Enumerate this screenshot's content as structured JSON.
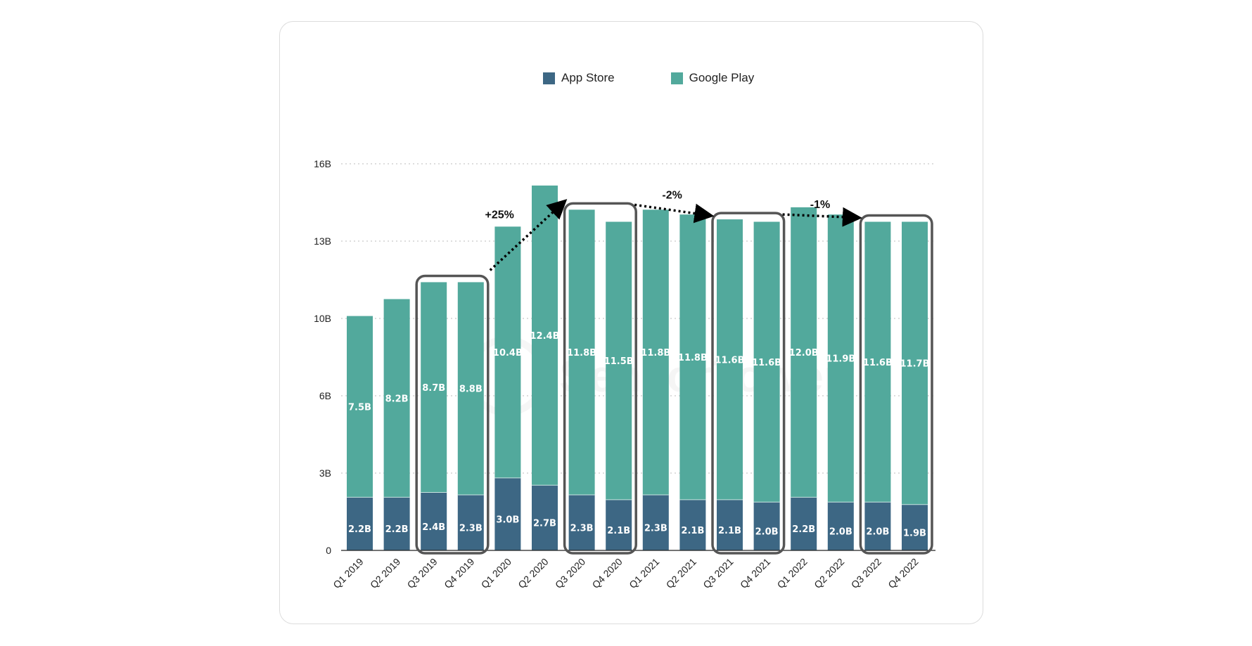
{
  "legend": [
    {
      "name": "App Store",
      "color": "#3d6784"
    },
    {
      "name": "Google Play",
      "color": "#52a99c"
    }
  ],
  "watermark": "SensorTower",
  "chart_data": {
    "type": "bar",
    "stacked": true,
    "title": "",
    "xlabel": "",
    "ylabel": "",
    "categories": [
      "Q1 2019",
      "Q2 2019",
      "Q3 2019",
      "Q4 2019",
      "Q1 2020",
      "Q2 2020",
      "Q3 2020",
      "Q4 2020",
      "Q1 2021",
      "Q2 2021",
      "Q3 2021",
      "Q4 2021",
      "Q1 2022",
      "Q2 2022",
      "Q3 2022",
      "Q4 2022"
    ],
    "series": [
      {
        "name": "App Store",
        "color": "#3d6784",
        "values": [
          2.2,
          2.2,
          2.4,
          2.3,
          3.0,
          2.7,
          2.3,
          2.1,
          2.3,
          2.1,
          2.1,
          2.0,
          2.2,
          2.0,
          2.0,
          1.9
        ],
        "labels": [
          "2.2B",
          "2.2B",
          "2.4B",
          "2.3B",
          "3.0B",
          "2.7B",
          "2.3B",
          "2.1B",
          "2.3B",
          "2.1B",
          "2.1B",
          "2.0B",
          "2.2B",
          "2.0B",
          "2.0B",
          "1.9B"
        ]
      },
      {
        "name": "Google Play",
        "color": "#52a99c",
        "values": [
          7.5,
          8.2,
          8.7,
          8.8,
          10.4,
          12.4,
          11.8,
          11.5,
          11.8,
          11.8,
          11.6,
          11.6,
          12.0,
          11.9,
          11.6,
          11.7
        ],
        "labels": [
          "7.5B",
          "8.2B",
          "8.7B",
          "8.8B",
          "10.4B",
          "12.4B",
          "11.8B",
          "11.5B",
          "11.8B",
          "11.8B",
          "11.6B",
          "11.6B",
          "12.0B",
          "11.9B",
          "11.6B",
          "11.7B"
        ]
      }
    ],
    "ylim": [
      0,
      16
    ],
    "yticks": [
      0,
      3.2,
      6.4,
      9.6,
      12.8,
      16
    ],
    "ytick_labels": [
      "0",
      "3B",
      "6B",
      "10B",
      "13B",
      "16B"
    ],
    "grid": "horizontal-dotted",
    "legend_position": "top-center",
    "highlight_boxes": [
      {
        "from": "Q3 2019",
        "to": "Q4 2019"
      },
      {
        "from": "Q3 2020",
        "to": "Q4 2020"
      },
      {
        "from": "Q3 2021",
        "to": "Q4 2021"
      },
      {
        "from": "Q3 2022",
        "to": "Q4 2022"
      }
    ],
    "annotations": [
      {
        "text": "+25%",
        "from": "Q3-Q4 2019",
        "to": "Q3-Q4 2020"
      },
      {
        "text": "-2%",
        "from": "Q3-Q4 2020",
        "to": "Q3-Q4 2021"
      },
      {
        "text": "-1%",
        "from": "Q3-Q4 2021",
        "to": "Q3-Q4 2022"
      }
    ]
  }
}
